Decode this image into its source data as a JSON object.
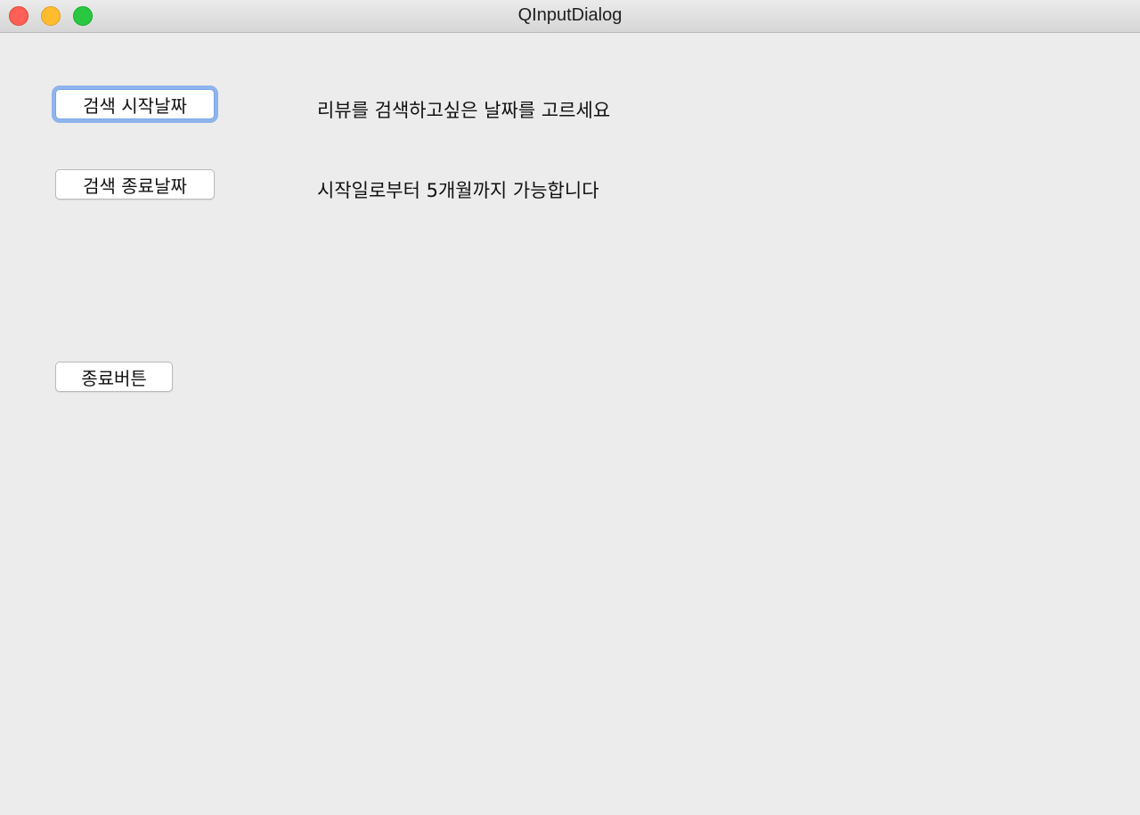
{
  "window": {
    "title": "QInputDialog"
  },
  "buttons": {
    "start_date": "검색 시작날짜",
    "end_date": "검색 종료날짜",
    "quit": "종료버튼"
  },
  "labels": {
    "start_hint": "리뷰를 검색하고싶은 날짜를 고르세요",
    "end_hint": "시작일로부터 5개월까지 가능합니다"
  },
  "colors": {
    "close": "#fe5f57",
    "minimize": "#febc2e",
    "zoom": "#28c840",
    "focus_ring": "#8fb3ec",
    "background": "#ececec"
  }
}
